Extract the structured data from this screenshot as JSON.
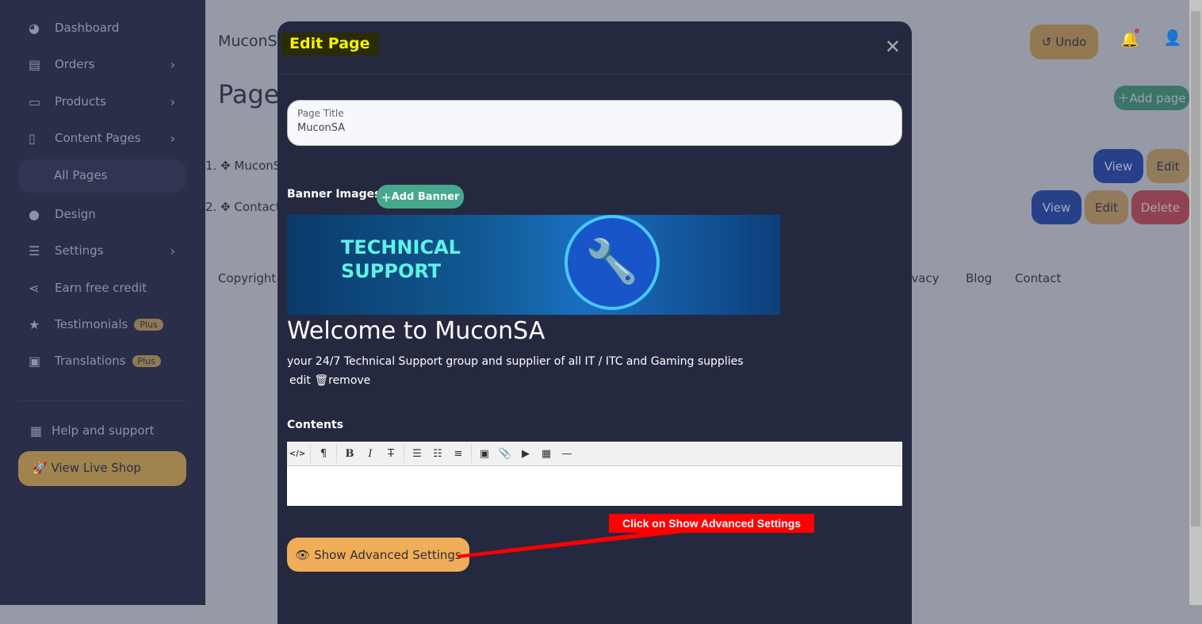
{
  "sidebar": {
    "items": [
      {
        "label": "Dashboard",
        "icon": "chart-pie-icon"
      },
      {
        "label": "Orders",
        "icon": "receipt-icon"
      },
      {
        "label": "Products",
        "icon": "box-open-icon"
      },
      {
        "label": "Content Pages",
        "icon": "file-icon"
      },
      {
        "label": "All Pages"
      },
      {
        "label": "Design",
        "icon": "palette-icon"
      },
      {
        "label": "Settings",
        "icon": "sliders-icon"
      },
      {
        "label": "Earn free credit",
        "icon": "share-icon"
      },
      {
        "label": "Testimonials",
        "badge": "Plus",
        "icon": "star-icon"
      },
      {
        "label": "Translations",
        "badge": "Plus",
        "icon": "language-icon"
      }
    ],
    "help": "Help and support",
    "live": "View Live Shop"
  },
  "main": {
    "shop_name": "MuconS",
    "heading": "Page",
    "undo": "Undo",
    "add_page": "Add page",
    "pages": [
      {
        "num": "1.",
        "name": "MuconS"
      },
      {
        "num": "2.",
        "name": "Contact"
      }
    ],
    "view": "View",
    "edit": "Edit",
    "delete": "Delete",
    "footer": {
      "copyright": "Copyright",
      "privacy": "rivacy",
      "blog": "Blog",
      "contact": "Contact"
    }
  },
  "modal": {
    "title": "Edit Page",
    "field_label": "Page Title",
    "field_value": "MuconSA",
    "banner_label": "Banner Images",
    "add_banner": "Add Banner",
    "banner_text": [
      "TECHNICAL",
      "SUPPORT"
    ],
    "welcome": "Welcome to MuconSA",
    "tagline": "your 24/7 Technical Support group and supplier of all IT / ITC and Gaming supplies",
    "edit": "edit",
    "remove": "remove",
    "contents": "Contents",
    "advanced": "Show Advanced Settings"
  },
  "annotation": "Click on Show Advanced Settings",
  "colors": {
    "accent": "#f0ae58",
    "teal": "#46a88c",
    "annotation": "#ff0000"
  }
}
